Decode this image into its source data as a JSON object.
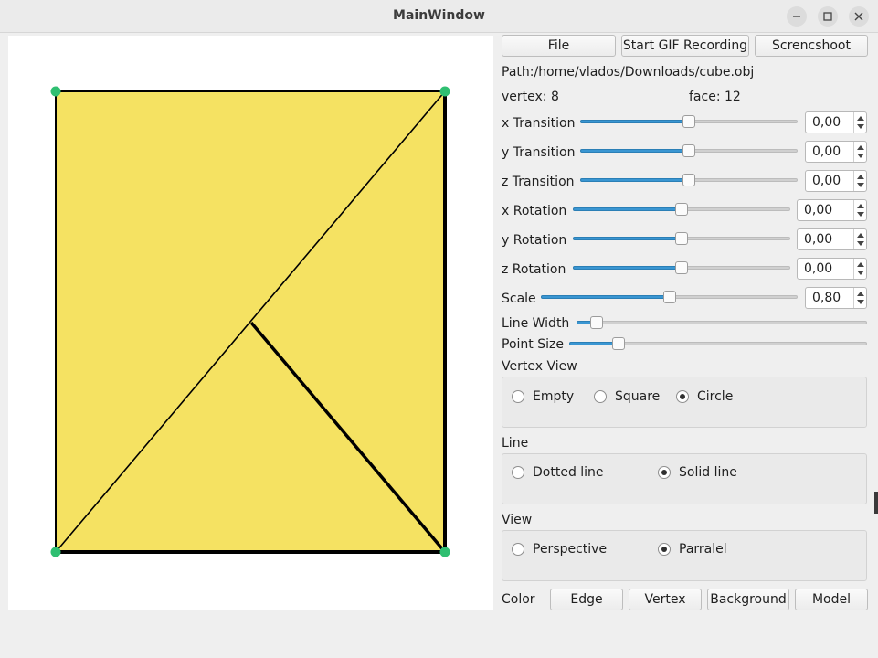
{
  "window": {
    "title": "MainWindow"
  },
  "toolbar": {
    "file": "File",
    "gif": "Start GIF Recording",
    "screenshot": "Screncshoot"
  },
  "info": {
    "path": "Path:/home/vlados/Downloads/cube.obj",
    "vertex": "vertex: 8",
    "face": "face: 12"
  },
  "controls": {
    "x_transition": {
      "label": "x Transition",
      "value": "0,00",
      "level": 0.5
    },
    "y_transition": {
      "label": "y Transition",
      "value": "0,00",
      "level": 0.5
    },
    "z_transition": {
      "label": "z Transition",
      "value": "0,00",
      "level": 0.5
    },
    "x_rotation": {
      "label": "x Rotation",
      "value": "0,00",
      "level": 0.5
    },
    "y_rotation": {
      "label": "y Rotation",
      "value": "0,00",
      "level": 0.5
    },
    "z_rotation": {
      "label": "z Rotation",
      "value": "0,00",
      "level": 0.5
    },
    "scale": {
      "label": "Scale",
      "value": "0,80",
      "level": 0.5
    },
    "line_width": {
      "label": "Line Width",
      "level": 0.05
    },
    "point_size": {
      "label": "Point Size",
      "level": 0.15
    }
  },
  "vertex_view": {
    "label": "Vertex View",
    "options": [
      "Empty",
      "Square",
      "Circle"
    ],
    "selected": "Circle"
  },
  "line": {
    "label": "Line",
    "options": [
      "Dotted line",
      "Solid line"
    ],
    "selected": "Solid line"
  },
  "view": {
    "label": "View",
    "options": [
      "Perspective",
      "Parralel"
    ],
    "selected": "Parralel"
  },
  "color": {
    "label": "Color",
    "buttons": [
      "Edge",
      "Vertex",
      "Background",
      "Model"
    ]
  },
  "colors": {
    "model_fill": "#f5e262",
    "edge": "#000000",
    "vertex": "#2fbf71",
    "accent": "#3a96d2"
  }
}
